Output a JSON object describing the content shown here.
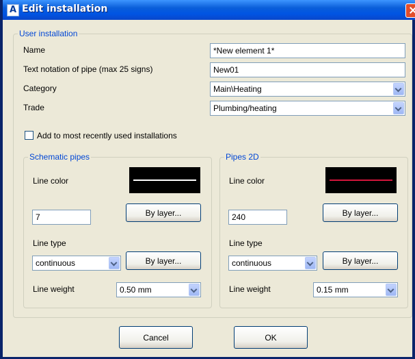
{
  "window": {
    "title": "Edit installation",
    "app_icon_glyph": "A"
  },
  "user_installation": {
    "legend": "User installation",
    "name_label": "Name",
    "name_value": "*New element 1*",
    "notation_label": "Text notation of pipe (max 25 signs)",
    "notation_value": "New01",
    "category_label": "Category",
    "category_value": "Main\\Heating",
    "trade_label": "Trade",
    "trade_value": "Plumbing/heating",
    "mru_label": "Add to most recently used installations",
    "mru_checked": false
  },
  "schematic": {
    "legend": "Schematic pipes",
    "line_color_label": "Line color",
    "swatch_line_color": "#ffffff",
    "color_value": "7",
    "by_layer_color": "By layer...",
    "line_type_label": "Line type",
    "line_type_value": "continuous",
    "by_layer_type": "By layer...",
    "line_weight_label": "Line weight",
    "line_weight_value": "0.50 mm"
  },
  "pipes2d": {
    "legend": "Pipes 2D",
    "line_color_label": "Line color",
    "swatch_line_color": "#d4163c",
    "color_value": "240",
    "by_layer_color": "By layer...",
    "line_type_label": "Line type",
    "line_type_value": "continuous",
    "by_layer_type": "By layer...",
    "line_weight_label": "Line weight",
    "line_weight_value": "0.15 mm"
  },
  "buttons": {
    "cancel": "Cancel",
    "ok": "OK"
  }
}
